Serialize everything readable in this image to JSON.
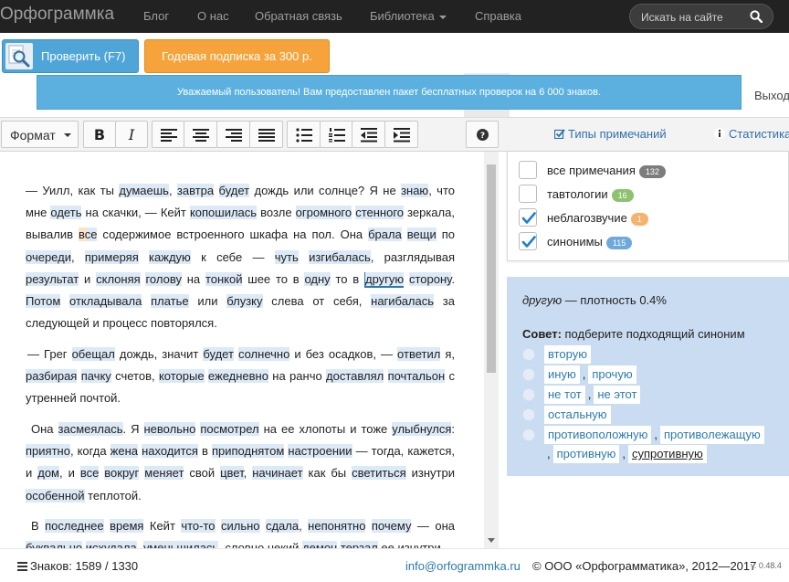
{
  "topnav": {
    "logo": "Орфограммка",
    "links": [
      "Блог",
      "О нас",
      "Обратная связь",
      "Библиотека",
      "Справка"
    ],
    "search_placeholder": "Искать на сайте",
    "search_icon": "search-icon"
  },
  "actions": {
    "check_label": "Проверить (F7)",
    "subscription_label": "Годовая подписка за 300 р."
  },
  "notice": {
    "text": "Уважаемый пользователь! Вам предоставлен пакет бесплатных проверок на 6 000 знаков."
  },
  "logout_label": "Выход",
  "toolbar": {
    "format_label": "Формат",
    "bold": "B",
    "italic": "I",
    "help_icon": "question-icon",
    "remark_types_label": "Типы примечаний",
    "stats_label": "Статистика"
  },
  "editor": {
    "paragraphs": [
      [
        {
          "t": "— Уилл, как ты "
        },
        {
          "t": "думаешь",
          "h": 1
        },
        {
          "t": ", "
        },
        {
          "t": "завтра",
          "h": 1
        },
        {
          "t": " "
        },
        {
          "t": "будет",
          "h": 1
        },
        {
          "t": " дождь или солнце? Я не "
        },
        {
          "t": "знаю",
          "h": 1
        },
        {
          "t": ", что мне "
        },
        {
          "t": "одеть",
          "h": 1
        },
        {
          "t": " на скачки, — Кейт "
        },
        {
          "t": "копошилась",
          "h": 1
        },
        {
          "t": " возле "
        },
        {
          "t": "огромного",
          "h": 1
        },
        {
          "t": " "
        },
        {
          "t": "стенного",
          "h": 1
        },
        {
          "t": " зеркала, вывалив "
        },
        {
          "t": "все",
          "h": 2
        },
        {
          "t": " содержимое встроенного шкафа на пол. Она "
        },
        {
          "t": "брала",
          "h": 1
        },
        {
          "t": " "
        },
        {
          "t": "вещи",
          "h": 1
        },
        {
          "t": " по "
        },
        {
          "t": "очереди",
          "h": 1
        },
        {
          "t": ", "
        },
        {
          "t": "примеряя",
          "h": 1
        },
        {
          "t": " "
        },
        {
          "t": "каждую",
          "h": 1
        },
        {
          "t": " к себе — "
        },
        {
          "t": "чуть",
          "h": 1
        },
        {
          "t": " "
        },
        {
          "t": "изгибалась",
          "h": 1
        },
        {
          "t": ", разглядывая "
        },
        {
          "t": "результат",
          "h": 1
        },
        {
          "t": " и "
        },
        {
          "t": "склоняя",
          "h": 1
        },
        {
          "t": " "
        },
        {
          "t": "голову",
          "h": 1
        },
        {
          "t": " на "
        },
        {
          "t": "тонкой",
          "h": 1
        },
        {
          "t": " шее то в "
        },
        {
          "t": "одну",
          "h": 1
        },
        {
          "t": " то в "
        },
        {
          "t": "другую",
          "h": 3
        },
        {
          "t": " "
        },
        {
          "t": "сторону",
          "h": 1
        },
        {
          "t": ". "
        },
        {
          "t": "Потом",
          "h": 1
        },
        {
          "t": " "
        },
        {
          "t": "откладывала",
          "h": 1
        },
        {
          "t": " "
        },
        {
          "t": "платье",
          "h": 1
        },
        {
          "t": " или "
        },
        {
          "t": "блузку",
          "h": 1
        },
        {
          "t": " слева от себя, "
        },
        {
          "t": "нагибалась",
          "h": 1
        },
        {
          "t": " за следующей и процесс повторялся."
        }
      ],
      [
        {
          "t": "— Грег "
        },
        {
          "t": "обещал",
          "h": 1
        },
        {
          "t": " дождь, значит "
        },
        {
          "t": "будет",
          "h": 1
        },
        {
          "t": " "
        },
        {
          "t": "солнечно",
          "h": 1
        },
        {
          "t": " и без осадков, — "
        },
        {
          "t": "ответил",
          "h": 1
        },
        {
          "t": " я, "
        },
        {
          "t": "разбирая",
          "h": 1
        },
        {
          "t": " "
        },
        {
          "t": "пачку",
          "h": 1
        },
        {
          "t": " счетов, "
        },
        {
          "t": "которые",
          "h": 1
        },
        {
          "t": " "
        },
        {
          "t": "ежедневно",
          "h": 1
        },
        {
          "t": " на ранчо "
        },
        {
          "t": "доставлял",
          "h": 1
        },
        {
          "t": " "
        },
        {
          "t": "почтальон",
          "h": 1
        },
        {
          "t": " с утренней почтой."
        }
      ],
      [
        {
          "t": "Она "
        },
        {
          "t": "засмеялась",
          "h": 1
        },
        {
          "t": ". Я "
        },
        {
          "t": "невольно",
          "h": 1
        },
        {
          "t": " "
        },
        {
          "t": "посмотрел",
          "h": 1
        },
        {
          "t": " на ее хлопоты и тоже "
        },
        {
          "t": "улыбнулся",
          "h": 1
        },
        {
          "t": ": "
        },
        {
          "t": "приятно",
          "h": 1
        },
        {
          "t": ", когда "
        },
        {
          "t": "жена",
          "h": 1
        },
        {
          "t": " "
        },
        {
          "t": "находится",
          "h": 1
        },
        {
          "t": " в "
        },
        {
          "t": "приподнятом",
          "h": 1
        },
        {
          "t": " "
        },
        {
          "t": "настроении",
          "h": 1
        },
        {
          "t": " — тогда, кажется, и "
        },
        {
          "t": "дом",
          "h": 1
        },
        {
          "t": ", и "
        },
        {
          "t": "все",
          "h": 1
        },
        {
          "t": " "
        },
        {
          "t": "вокруг",
          "h": 1
        },
        {
          "t": " "
        },
        {
          "t": "меняет",
          "h": 1
        },
        {
          "t": " свой "
        },
        {
          "t": "цвет",
          "h": 1
        },
        {
          "t": ", "
        },
        {
          "t": "начинает",
          "h": 1
        },
        {
          "t": " как бы "
        },
        {
          "t": "светиться",
          "h": 1
        },
        {
          "t": " изнутри "
        },
        {
          "t": "особенной",
          "h": 1
        },
        {
          "t": " теплотой."
        }
      ],
      [
        {
          "t": "В "
        },
        {
          "t": "последнее",
          "h": 1
        },
        {
          "t": " "
        },
        {
          "t": "время",
          "h": 1
        },
        {
          "t": " Кейт "
        },
        {
          "t": "что-то",
          "h": 1
        },
        {
          "t": " "
        },
        {
          "t": "сильно",
          "h": 1
        },
        {
          "t": " "
        },
        {
          "t": "сдала",
          "h": 1
        },
        {
          "t": ", "
        },
        {
          "t": "непонятно",
          "h": 1
        },
        {
          "t": " "
        },
        {
          "t": "почему",
          "h": 1
        },
        {
          "t": " — она "
        },
        {
          "t": "буквально",
          "h": 1
        },
        {
          "t": " "
        },
        {
          "t": "исхудала",
          "h": 1
        },
        {
          "t": ", "
        },
        {
          "t": "уменьшилась",
          "h": 1
        },
        {
          "t": ", словно некий "
        },
        {
          "t": "демон",
          "h": 1
        },
        {
          "t": " "
        },
        {
          "t": "терзал",
          "h": 1
        },
        {
          "t": " ее изнутри."
        }
      ]
    ]
  },
  "remarks": {
    "items": [
      {
        "label": "все примечания",
        "count": "132",
        "checked": false,
        "color": "#7d7d7d"
      },
      {
        "label": "тавтологии",
        "count": "16",
        "checked": false,
        "color": "#8dc26f"
      },
      {
        "label": "неблагозвучие",
        "count": "1",
        "checked": true,
        "color": "#f5b36b"
      },
      {
        "label": "синонимы",
        "count": "115",
        "checked": true,
        "color": "#6fa9dc"
      }
    ]
  },
  "advice": {
    "word": "другую",
    "density": " — плотность 0.4%",
    "tip_label": "Совет:",
    "tip_text": " подберите подходящий синоним",
    "options": [
      [
        "вторую"
      ],
      [
        "иную",
        "прочую"
      ],
      [
        "не тот",
        "не этот"
      ],
      [
        "остальную"
      ],
      [
        "противоположную",
        "противолежащую",
        "противную",
        "супротивную"
      ]
    ]
  },
  "footer": {
    "counter": "Знаков: 1589 / 1330",
    "email": "info@orfogrammka.ru",
    "copyright": "© ООО «Орфограмматика», 2012—2017",
    "version": "v. 0.48.4"
  },
  "colors": {
    "highlight_synonym": "#dce9f6",
    "highlight_euphony": "#fbe3c8",
    "selected_underline": "#2a7ab0",
    "advice_bg": "#c9dcf1",
    "check_button": "#4fa5d8",
    "subscription_button": "#f7a33b"
  }
}
